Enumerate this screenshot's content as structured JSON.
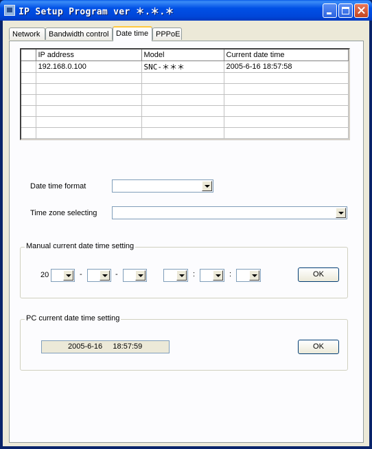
{
  "window": {
    "title": "IP Setup Program ver ＊.＊.＊"
  },
  "tabs": [
    {
      "label": "Network"
    },
    {
      "label": "Bandwidth control"
    },
    {
      "label": "Date time"
    },
    {
      "label": "PPPoE"
    }
  ],
  "table": {
    "columns": [
      "",
      "IP address",
      "Model",
      "Current date time"
    ],
    "rows": [
      [
        "",
        "192.168.0.100",
        "SNC-＊＊＊",
        "2005-6-16  18:57:58"
      ],
      [
        "",
        "",
        "",
        ""
      ],
      [
        "",
        "",
        "",
        ""
      ],
      [
        "",
        "",
        "",
        ""
      ],
      [
        "",
        "",
        "",
        ""
      ],
      [
        "",
        "",
        "",
        ""
      ],
      [
        "",
        "",
        "",
        ""
      ]
    ]
  },
  "form": {
    "date_time_format_label": "Date time format",
    "date_time_format_value": "",
    "time_zone_label": "Time zone selecting",
    "time_zone_value": ""
  },
  "manual": {
    "title": "Manual current date time setting",
    "year_prefix": "20",
    "date_sep": "-",
    "time_sep": ":",
    "ok_label": "OK"
  },
  "pc": {
    "title": "PC current date time setting",
    "value": "2005-6-16     18:57:59",
    "ok_label": "OK"
  },
  "colors": {
    "titlebar": "#0054e3",
    "face": "#ece9d8",
    "panel": "#fcfcfe",
    "tab_highlight": "#ffc83c"
  }
}
